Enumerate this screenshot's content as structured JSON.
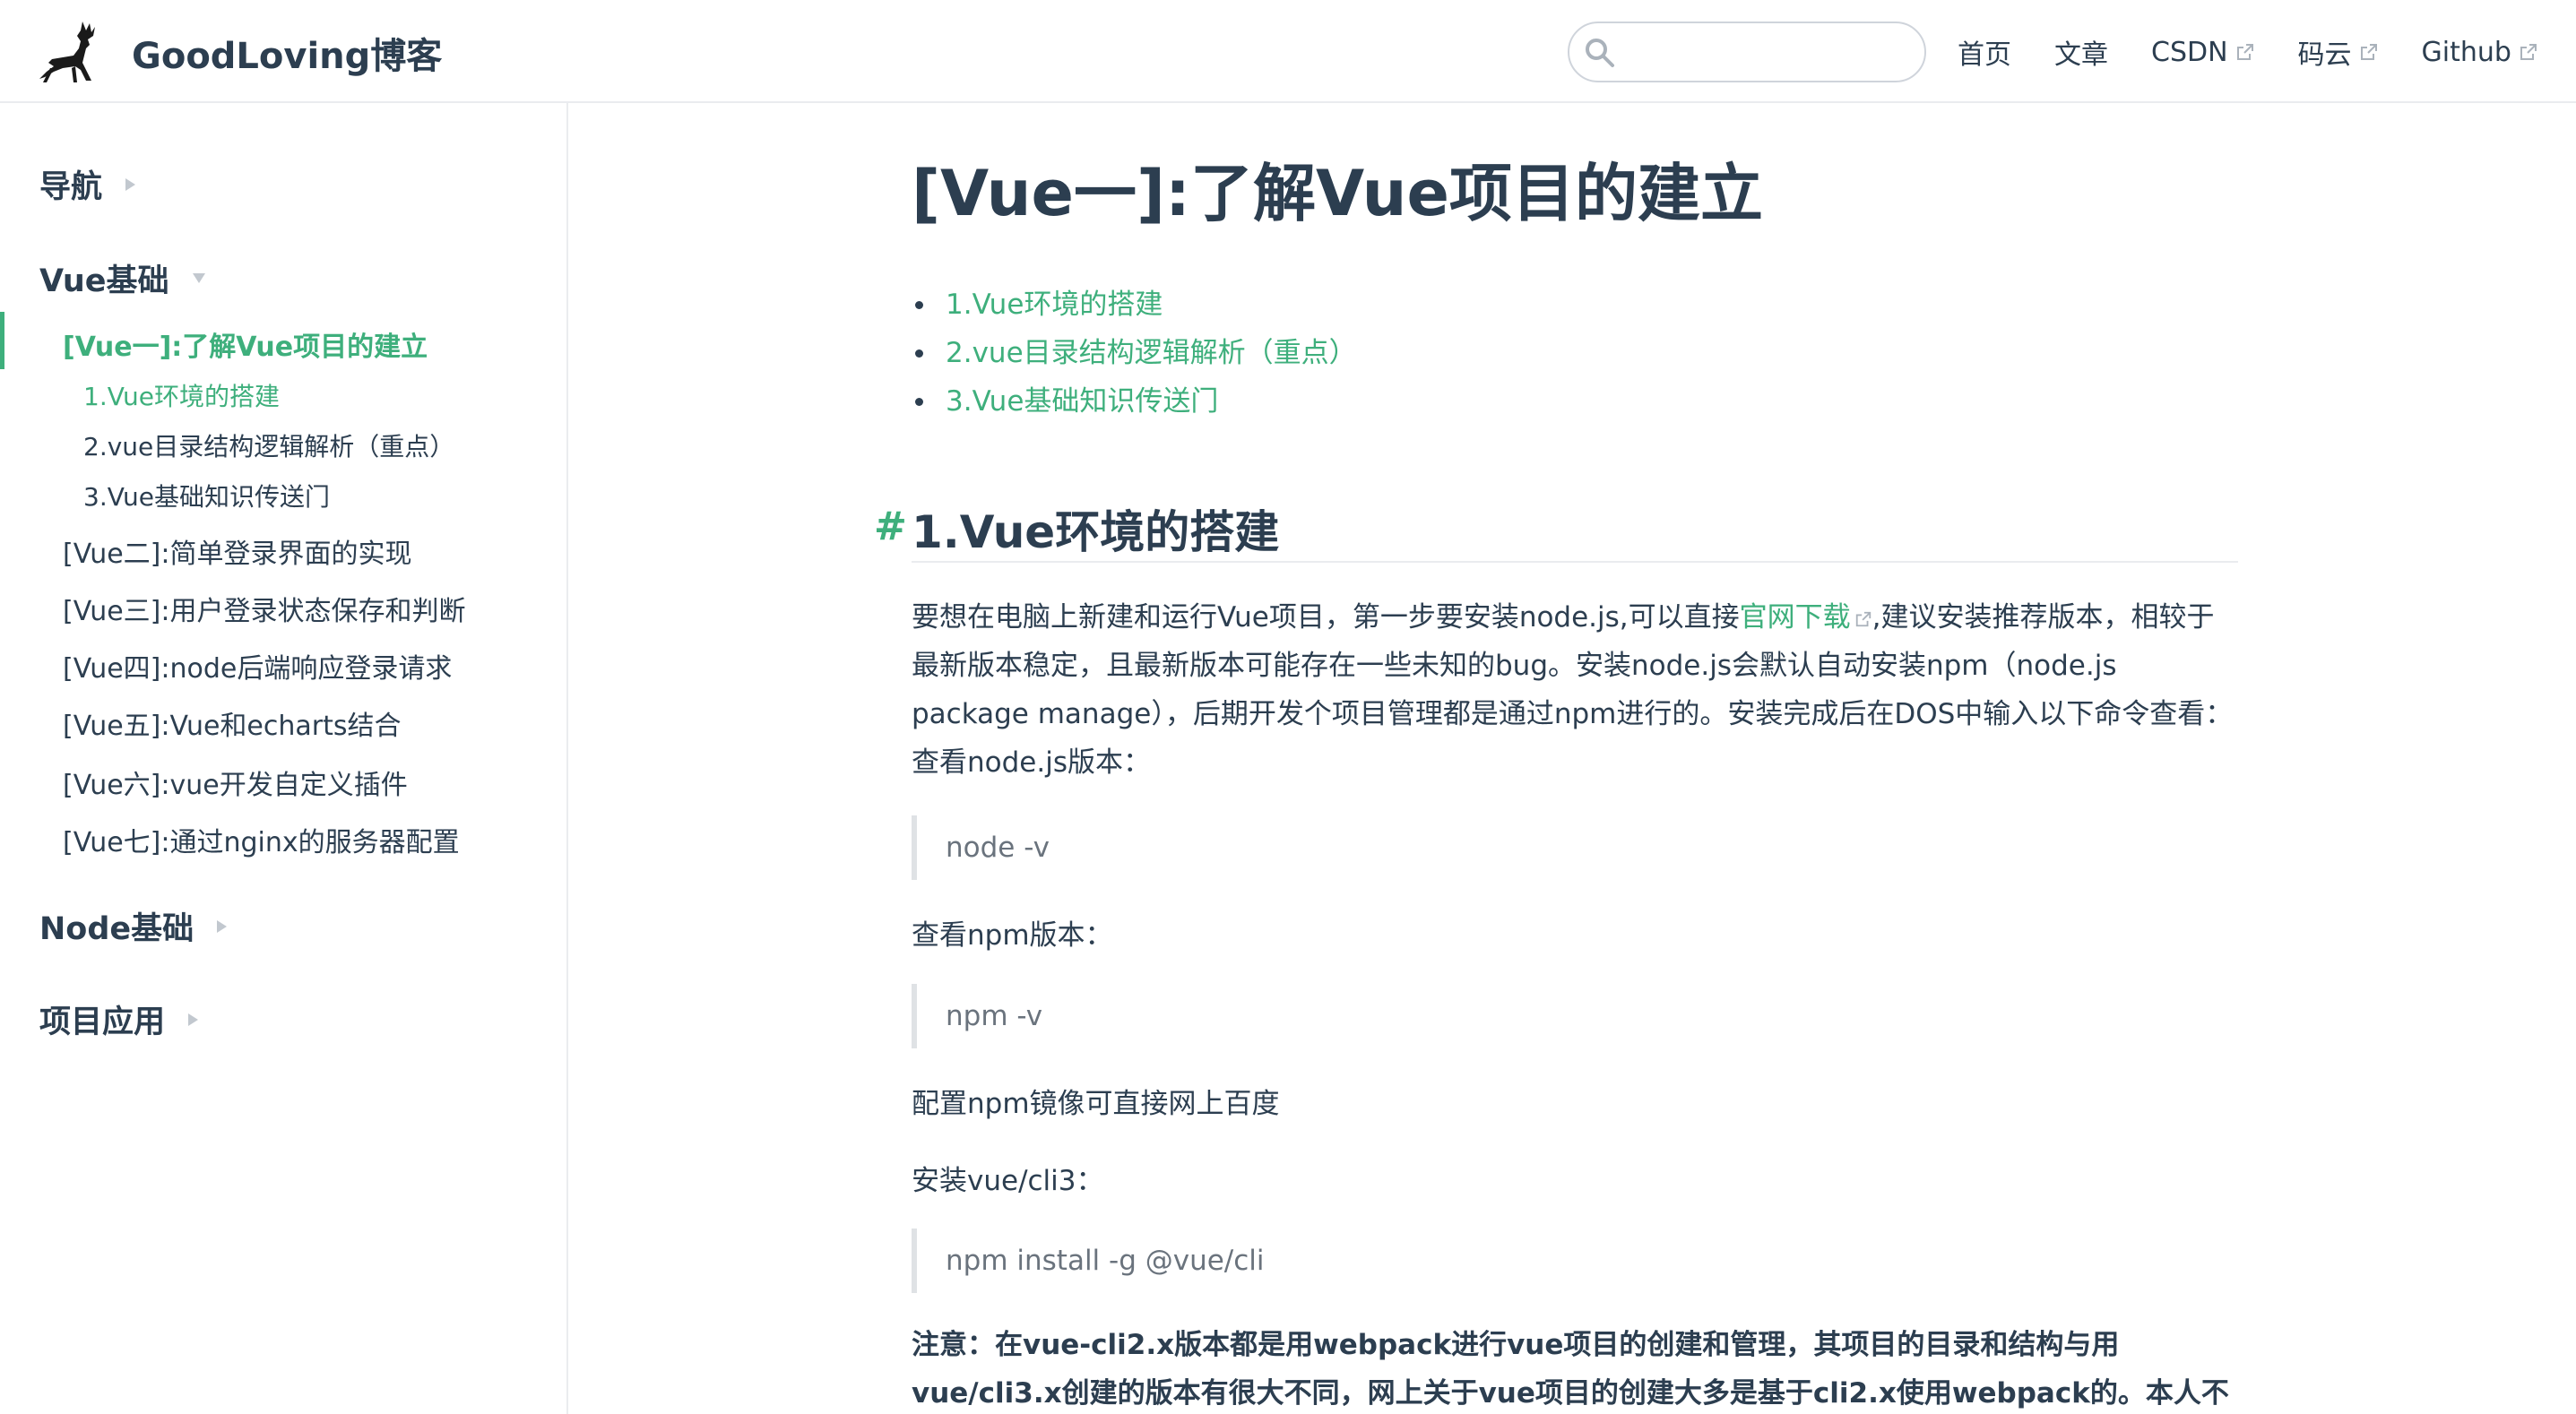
{
  "navbar": {
    "site_name": "GoodLoving博客",
    "search_placeholder": "",
    "links": [
      {
        "label": "首页",
        "external": false
      },
      {
        "label": "文章",
        "external": false
      },
      {
        "label": "CSDN",
        "external": true
      },
      {
        "label": "码云",
        "external": true
      },
      {
        "label": "Github",
        "external": true
      }
    ]
  },
  "sidebar": {
    "groups": [
      {
        "title": "导航",
        "state": "collapsed"
      },
      {
        "title": "Vue基础",
        "state": "expanded"
      },
      {
        "title": "Node基础",
        "state": "collapsed"
      },
      {
        "title": "项目应用",
        "state": "collapsed"
      }
    ],
    "vue_items": [
      {
        "label": "[Vue一]:了解Vue项目的建立",
        "active": true
      },
      {
        "label": "[Vue二]:简单登录界面的实现",
        "active": false
      },
      {
        "label": "[Vue三]:用户登录状态保存和判断",
        "active": false
      },
      {
        "label": "[Vue四]:node后端响应登录请求",
        "active": false
      },
      {
        "label": "[Vue五]:Vue和echarts结合",
        "active": false
      },
      {
        "label": "[Vue六]:vue开发自定义插件",
        "active": false
      },
      {
        "label": "[Vue七]:通过nginx的服务器配置",
        "active": false
      }
    ],
    "sub_items": [
      {
        "label": "1.Vue环境的搭建",
        "active": true
      },
      {
        "label": "2.vue目录结构逻辑解析（重点）",
        "active": false
      },
      {
        "label": "3.Vue基础知识传送门",
        "active": false
      }
    ]
  },
  "content": {
    "title": "[Vue一]:了解Vue项目的建立",
    "toc": [
      "1.Vue环境的搭建",
      "2.vue目录结构逻辑解析（重点）",
      "3.Vue基础知识传送门"
    ],
    "h2_anchor": "#",
    "h2": "1.Vue环境的搭建",
    "para1_before": "要想在电脑上新建和运行Vue项目，第一步要安装node.js,可以直接",
    "para1_link": "官网下载",
    "para1_after": ",建议安装推荐版本，相较于最新版本稳定，且最新版本可能存在一些未知的bug。安装node.js会默认自动安装npm（node.js package manage），后期开发个项目管理都是通过npm进行的。安装完成后在DOS中输入以下命令查看： 查看node.js版本：",
    "quote1": "node -v",
    "line2": "查看npm版本：",
    "quote2": "npm -v",
    "line3": "配置npm镜像可直接网上百度",
    "line4": "安装vue/cli3：",
    "quote3": "npm install -g @vue/cli",
    "note": "注意：在vue-cli2.x版本都是用webpack进行vue项目的创建和管理，其项目的目录和结构与用vue/cli3.x创建的版本有很大不同，网上关于vue项目的创建大多是基于cli2.x使用webpack的。本人不建议再用"
  },
  "colors": {
    "accent": "#3eaf7c",
    "text": "#2c3e50",
    "border": "#eaecef"
  }
}
